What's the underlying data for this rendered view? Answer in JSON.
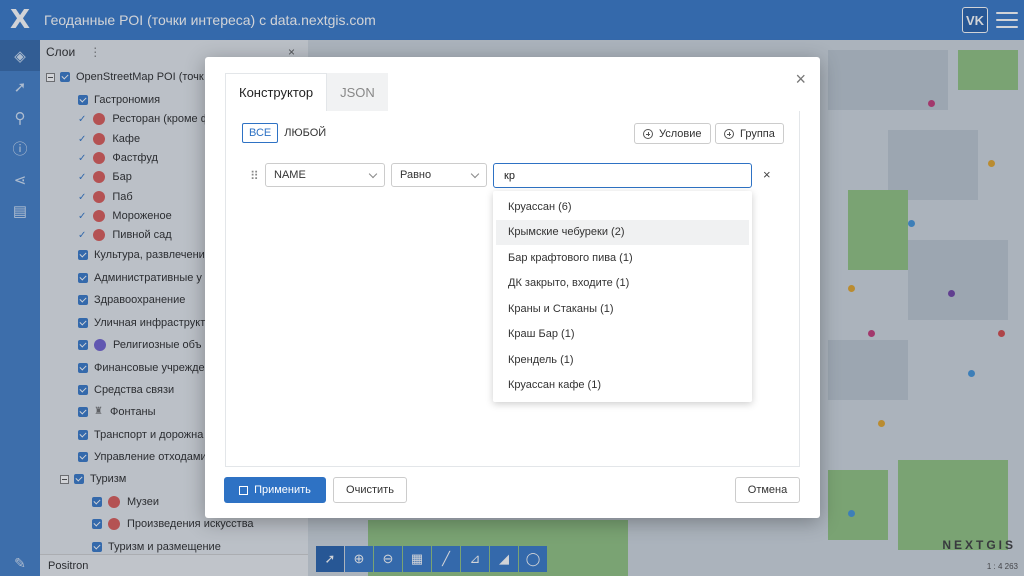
{
  "header": {
    "logo": "X",
    "title": "Геоданные POI (точки интереса) с data.nextgis.com",
    "user_badge": "VK"
  },
  "panel": {
    "title": "Слои",
    "dots": "⋮",
    "close": "×",
    "footer": "Positron",
    "rows": [
      {
        "label": "OpenStreetMap POI (точк"
      },
      {
        "label": "Гастрономия"
      },
      {
        "label": "Ресторан (кроме ф"
      },
      {
        "label": "Кафе"
      },
      {
        "label": "Фастфуд"
      },
      {
        "label": "Бар"
      },
      {
        "label": "Паб"
      },
      {
        "label": "Мороженое"
      },
      {
        "label": "Пивной сад"
      },
      {
        "label": "Культура, развлечени"
      },
      {
        "label": "Административные у"
      },
      {
        "label": "Здравоохранение"
      },
      {
        "label": "Уличная инфраструкт"
      },
      {
        "label": "Религиозные объ"
      },
      {
        "label": "Финансовые учрежде"
      },
      {
        "label": "Средства связи"
      },
      {
        "label": "Фонтаны"
      },
      {
        "label": "Транспорт и дорожна"
      },
      {
        "label": "Управление отходами"
      },
      {
        "label": "Туризм"
      },
      {
        "label": "Музеи"
      },
      {
        "label": "Произведения искусства"
      },
      {
        "label": "Туризм и размещение"
      }
    ]
  },
  "map": {
    "brand": "NEXTGIS",
    "scale": "1 : 4 263"
  },
  "modal": {
    "close": "×",
    "tabs": [
      {
        "label": "Конструктор"
      },
      {
        "label": "JSON"
      }
    ],
    "mode": {
      "all": "ВСЕ",
      "any": "ЛЮБОЙ"
    },
    "add_condition": "Условие",
    "add_group": "Группа",
    "rule": {
      "drag": "⠿",
      "field": "NAME",
      "operator": "Равно",
      "value": "кр",
      "remove": "×"
    },
    "suggestions": [
      "Круассан (6)",
      "Крымские чебуреки (2)",
      "Бар крафтового пива (1)",
      "ДК закрыто, входите (1)",
      "Краны и Стаканы (1)",
      "Краш Бар (1)",
      "Крендель (1)",
      "Круассан кафе (1)"
    ],
    "apply": "Применить",
    "clear": "Очистить",
    "cancel": "Отмена"
  }
}
